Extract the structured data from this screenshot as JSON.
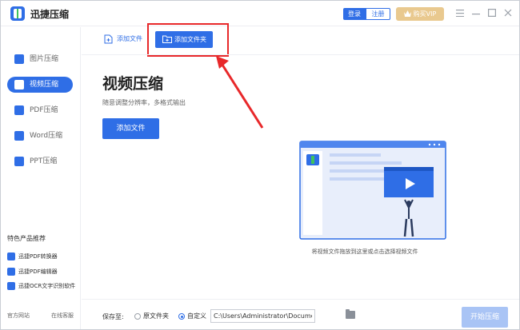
{
  "app": {
    "title": "迅捷压缩"
  },
  "header": {
    "login_label": "登录",
    "register_label": "注册",
    "vip_label": "购买VIP",
    "menu_icon": "menu-icon",
    "minimize_icon": "minimize-icon",
    "maximize_icon": "maximize-icon",
    "close_icon": "close-icon"
  },
  "sidebar": {
    "items": [
      {
        "label": "图片压缩",
        "icon": "image-icon",
        "active": false
      },
      {
        "label": "视频压缩",
        "icon": "video-icon",
        "active": true
      },
      {
        "label": "PDF压缩",
        "icon": "pdf-icon",
        "active": false
      },
      {
        "label": "Word压缩",
        "icon": "word-icon",
        "active": false
      },
      {
        "label": "PPT压缩",
        "icon": "ppt-icon",
        "active": false
      }
    ],
    "products_title": "特色产品推荐",
    "products": [
      {
        "label": "迅捷PDF转换器"
      },
      {
        "label": "迅捷PDF编辑器"
      },
      {
        "label": "迅捷OCR文字识别软件"
      }
    ],
    "footer_left": "官方网站",
    "footer_right": "在线客服"
  },
  "toolbar": {
    "add_file_label": "添加文件",
    "add_folder_label": "添加文件夹"
  },
  "main": {
    "headline": "视频压缩",
    "subline": "随意调整分辨率，多格式输出",
    "add_file_button": "添加文件",
    "drop_hint": "将视频文件拖放到这里或点击选择视频文件"
  },
  "bottom": {
    "save_label": "保存至:",
    "option_original": "原文件夹",
    "option_custom": "自定义",
    "selected_option": "自定义",
    "path_value": "C:\\Users\\Administrator\\Documents",
    "start_label": "开始压缩"
  },
  "colors": {
    "accent": "#2f6ee6",
    "highlight": "#e8282a",
    "vip": "#e9c98f",
    "start_disabled": "#a9c4f5"
  }
}
